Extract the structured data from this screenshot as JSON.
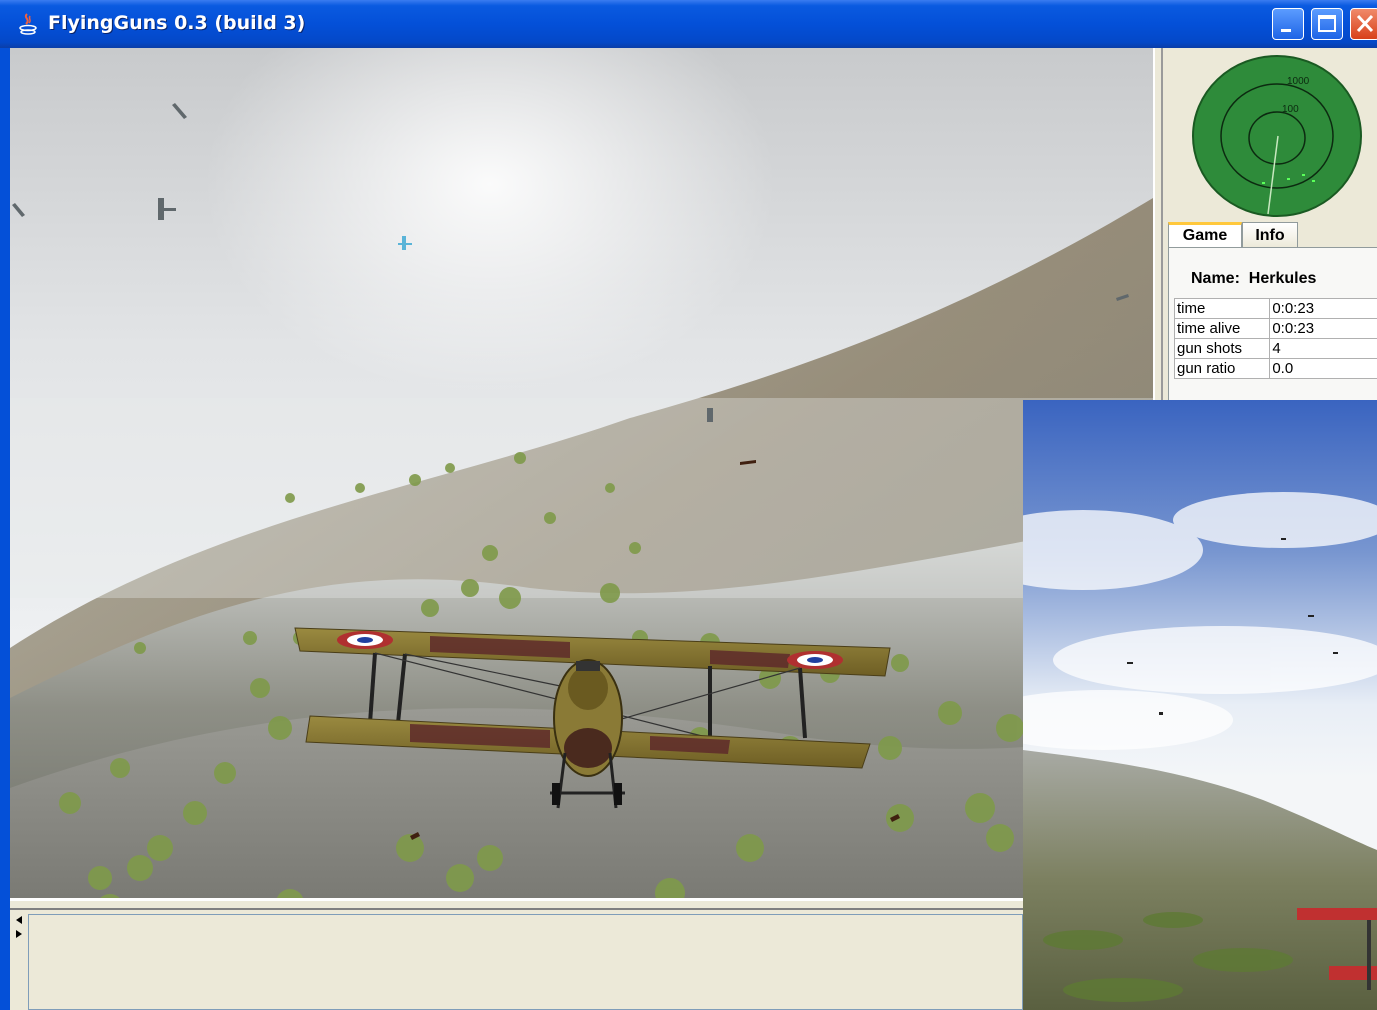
{
  "window": {
    "title": "FlyingGuns 0.3 (build 3)"
  },
  "radar": {
    "ring_outer_label": "1000",
    "ring_inner_label": "100",
    "color": "#2e8b3a"
  },
  "tabs": [
    {
      "label": "Game",
      "selected": true
    },
    {
      "label": "Info",
      "selected": false
    }
  ],
  "player": {
    "name_label": "Name:",
    "name": "Herkules"
  },
  "stats": [
    {
      "key": "time",
      "value": "0:0:23"
    },
    {
      "key": "time alive",
      "value": "0:0:23"
    },
    {
      "key": "gun shots",
      "value": "4"
    },
    {
      "key": "gun ratio",
      "value": "0.0"
    }
  ],
  "colors": {
    "titlebar": "#0450d8",
    "panel": "#ece9d8",
    "tab_highlight": "#ffc83c"
  }
}
